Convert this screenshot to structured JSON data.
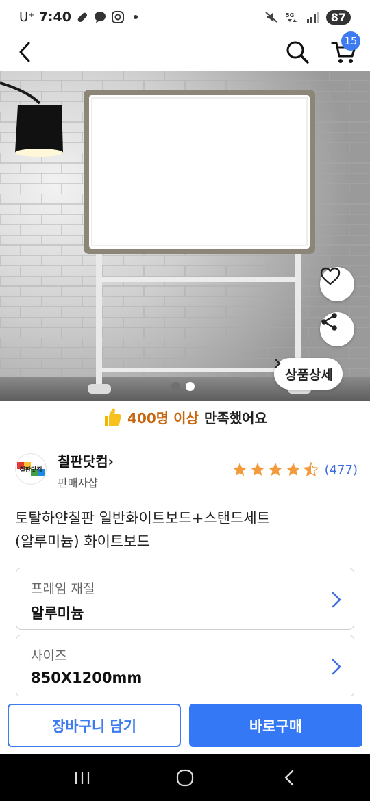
{
  "status_bar": {
    "carrier": "U⁺",
    "time": "7:40",
    "left_icons": [
      "link-icon",
      "chat-icon",
      "instagram-icon",
      "dot-icon"
    ],
    "right_icons": [
      "mute-icon",
      "5g-icon",
      "signal-icon"
    ],
    "battery": "87"
  },
  "nav": {
    "back_icon": "chevron-left-icon",
    "search_icon": "search-icon",
    "cart_icon": "cart-icon",
    "cart_count": "15"
  },
  "hero": {
    "wish_icon": "heart-icon",
    "share_icon": "share-icon",
    "detail_label": "상품상세",
    "dots_total": 2,
    "dots_active_index": 1
  },
  "satisfied": {
    "icon": "thumbs-up-icon",
    "count_text": "400명 이상",
    "suffix": "만족했어요"
  },
  "seller": {
    "name": "칠판닷컴",
    "chevron": "›",
    "type": "판매자샵",
    "logo_text": "칠판닷컴",
    "rating": 4.5,
    "review_count": "(477)"
  },
  "product": {
    "title_line1": "토탈하얀칠판 일반화이트보드+스탠드세트",
    "title_line2": "(알루미늄) 화이트보드"
  },
  "options": [
    {
      "label": "프레임 재질",
      "value": "알루미늄"
    },
    {
      "label": "사이즈",
      "value": "850X1200mm"
    }
  ],
  "actions": {
    "cart_add": "장바구니 담기",
    "buy_now": "바로구매"
  },
  "system_nav": [
    "recent-apps-icon",
    "home-icon",
    "back-icon"
  ],
  "colors": {
    "accent": "#3478f6",
    "highlight": "#c8660f",
    "star": "#f39a3c",
    "link": "#3d6ee0"
  }
}
